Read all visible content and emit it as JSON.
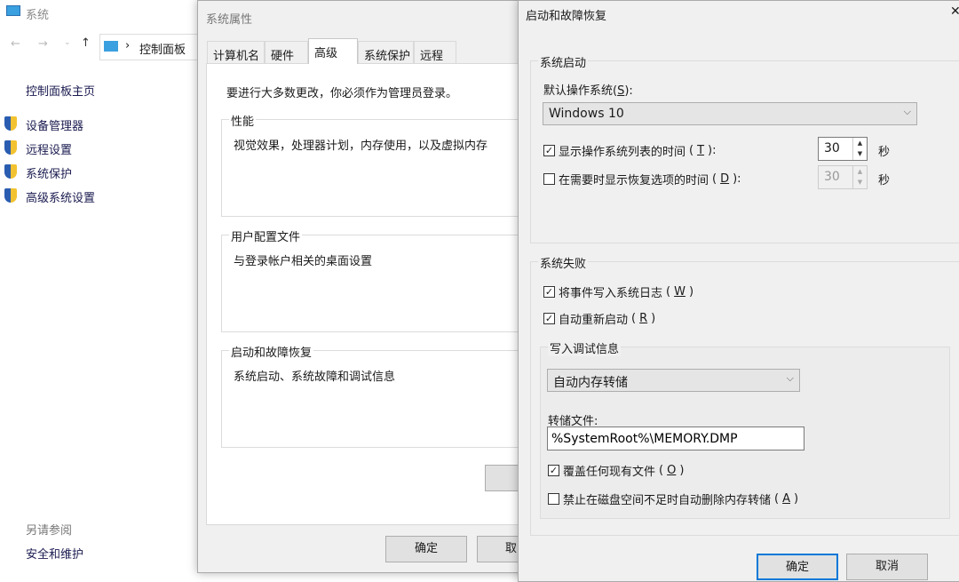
{
  "system_window": {
    "title": "系统",
    "breadcrumb": "控制面板",
    "sidebar_home": "控制面板主页",
    "links": [
      "设备管理器",
      "远程设置",
      "系统保护",
      "高级系统设置"
    ],
    "see_also": "另请参阅",
    "see_also_link": "安全和维护"
  },
  "sysprops": {
    "title": "系统属性",
    "tabs": [
      "计算机名",
      "硬件",
      "高级",
      "系统保护",
      "远程"
    ],
    "active_tab": "高级",
    "admin_note": "要进行大多数更改，你必须作为管理员登录。",
    "groups": [
      {
        "label": "性能",
        "text": "视觉效果，处理器计划，内存使用，以及虚拟内存"
      },
      {
        "label": "用户配置文件",
        "text": "与登录帐户相关的桌面设置"
      },
      {
        "label": "启动和故障恢复",
        "text": "系统启动、系统故障和调试信息"
      }
    ],
    "ok": "确定",
    "cancel": "取"
  },
  "startup": {
    "title": "启动和故障恢复",
    "close": "✕",
    "system_startup": {
      "label": "系统启动",
      "default_os_label": "默认操作系统",
      "default_os_key": "S",
      "default_os": "Windows 10",
      "show_list": {
        "label": "显示操作系统列表的时间",
        "key": "T",
        "checked": true,
        "value": "30",
        "unit": "秒"
      },
      "show_recovery": {
        "label": "在需要时显示恢复选项的时间",
        "key": "D",
        "checked": false,
        "value": "30",
        "unit": "秒"
      }
    },
    "system_failure": {
      "label": "系统失败",
      "write_event": {
        "label": "将事件写入系统日志",
        "key": "W",
        "checked": true
      },
      "auto_restart": {
        "label": "自动重新启动",
        "key": "R",
        "checked": true
      },
      "debug": {
        "label": "写入调试信息",
        "type": "自动内存转储",
        "dump_file_label": "转储文件:",
        "dump_file": "%SystemRoot%\\MEMORY.DMP",
        "overwrite": {
          "label": "覆盖任何现有文件",
          "key": "O",
          "checked": true
        },
        "disable_auto_delete": {
          "label": "禁止在磁盘空间不足时自动删除内存转储",
          "key": "A",
          "checked": false
        }
      }
    },
    "ok": "确定",
    "cancel": "取消"
  }
}
